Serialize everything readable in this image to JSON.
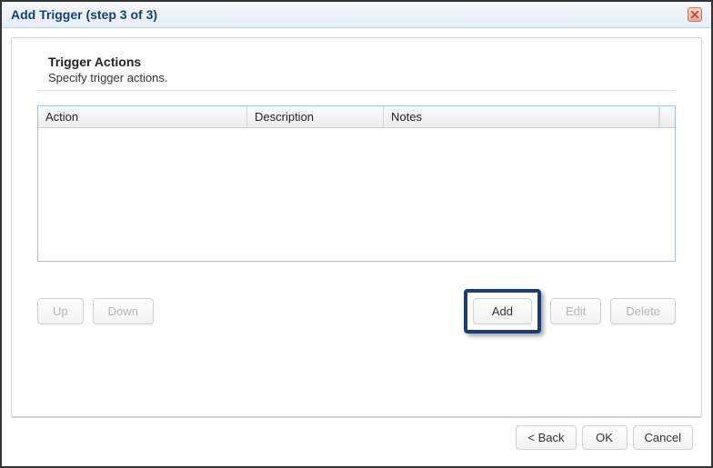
{
  "dialog": {
    "title": "Add Trigger (step 3 of 3)"
  },
  "section": {
    "title": "Trigger Actions",
    "subtitle": "Specify trigger actions."
  },
  "table": {
    "columns": {
      "action": "Action",
      "description": "Description",
      "notes": "Notes"
    },
    "rows": []
  },
  "buttons": {
    "up": "Up",
    "down": "Down",
    "add": "Add",
    "edit": "Edit",
    "delete": "Delete"
  },
  "footer": {
    "back": "< Back",
    "ok": "OK",
    "cancel": "Cancel"
  }
}
